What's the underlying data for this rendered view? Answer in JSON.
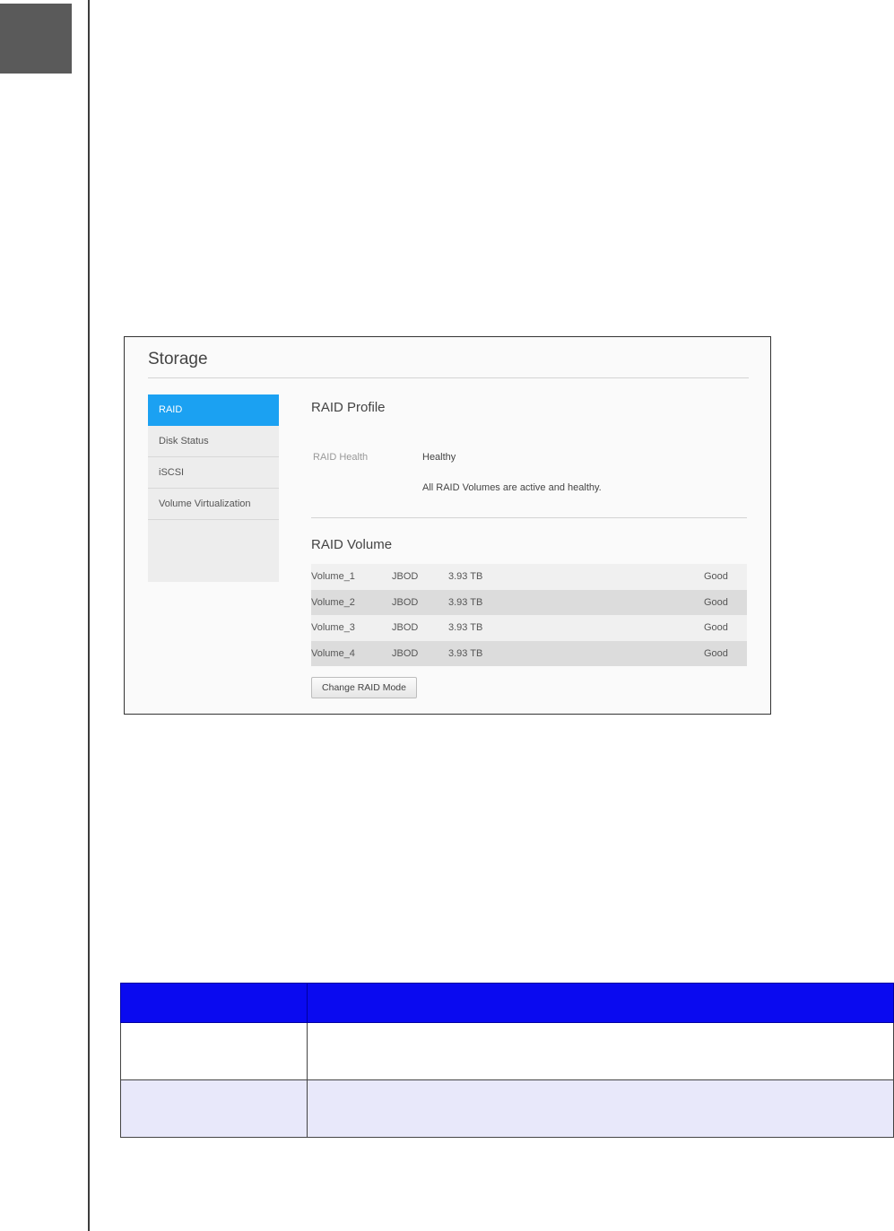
{
  "storage": {
    "title": "Storage",
    "menu": [
      {
        "label": "RAID",
        "active": true
      },
      {
        "label": "Disk Status",
        "active": false
      },
      {
        "label": "iSCSI",
        "active": false
      },
      {
        "label": "Volume Virtualization",
        "active": false
      }
    ],
    "raid_profile": {
      "title": "RAID Profile",
      "health_label": "RAID Health",
      "health_value": "Healthy",
      "health_description": "All RAID Volumes are active and healthy."
    },
    "raid_volume": {
      "title": "RAID Volume",
      "rows": [
        {
          "name": "Volume_1",
          "type": "JBOD",
          "size": "3.93 TB",
          "status": "Good"
        },
        {
          "name": "Volume_2",
          "type": "JBOD",
          "size": "3.93 TB",
          "status": "Good"
        },
        {
          "name": "Volume_3",
          "type": "JBOD",
          "size": "3.93 TB",
          "status": "Good"
        },
        {
          "name": "Volume_4",
          "type": "JBOD",
          "size": "3.93 TB",
          "status": "Good"
        }
      ]
    },
    "change_raid_button": "Change RAID Mode",
    "accent_color": "#1ba1f2"
  }
}
